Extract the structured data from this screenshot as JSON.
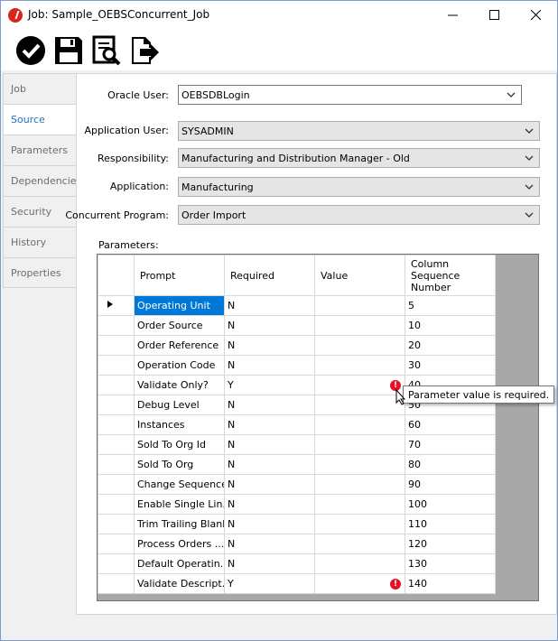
{
  "window": {
    "title": "Job: Sample_OEBSConcurrent_Job",
    "brand_color": "#d9261c"
  },
  "toolbar": {
    "icons": [
      "check-circle-icon",
      "save-icon",
      "search-document-icon",
      "export-icon"
    ]
  },
  "tabs": [
    "Job",
    "Source",
    "Parameters",
    "Dependencies",
    "Security",
    "History",
    "Properties"
  ],
  "form": {
    "oracle_user_label": "Oracle User:",
    "oracle_user_value": "OEBSDBLogin",
    "app_user_label": "Application User:",
    "app_user_value": "SYSADMIN",
    "responsibility_label": "Responsibility:",
    "responsibility_value": "Manufacturing and Distribution Manager - Old",
    "application_label": "Application:",
    "application_value": "Manufacturing",
    "program_label": "Concurrent Program:",
    "program_value": "Order Import",
    "parameters_label": "Parameters:"
  },
  "grid": {
    "headers": {
      "prompt": "Prompt",
      "required": "Required",
      "value": "Value",
      "seq_line1": "Column",
      "seq_line2": "Sequence",
      "seq_line3": "Number"
    },
    "rows": [
      {
        "prompt": "Operating Unit",
        "required": "N",
        "value": "",
        "seq": "5"
      },
      {
        "prompt": "Order Source",
        "required": "N",
        "value": "",
        "seq": "10"
      },
      {
        "prompt": "Order Reference",
        "required": "N",
        "value": "",
        "seq": "20"
      },
      {
        "prompt": "Operation Code",
        "required": "N",
        "value": "",
        "seq": "30"
      },
      {
        "prompt": "Validate Only?",
        "required": "Y",
        "value": "",
        "seq": "40"
      },
      {
        "prompt": "Debug Level",
        "required": "N",
        "value": "",
        "seq": "50"
      },
      {
        "prompt": "Instances",
        "required": "N",
        "value": "",
        "seq": "60"
      },
      {
        "prompt": "Sold To Org Id",
        "required": "N",
        "value": "",
        "seq": "70"
      },
      {
        "prompt": "Sold To Org",
        "required": "N",
        "value": "",
        "seq": "80"
      },
      {
        "prompt": "Change Sequence",
        "required": "N",
        "value": "",
        "seq": "90"
      },
      {
        "prompt": "Enable Single Lin...",
        "required": "N",
        "value": "",
        "seq": "100"
      },
      {
        "prompt": "Trim Trailing Blanks",
        "required": "N",
        "value": "",
        "seq": "110"
      },
      {
        "prompt": "Process Orders ...",
        "required": "N",
        "value": "",
        "seq": "120"
      },
      {
        "prompt": "Default Operatin...",
        "required": "N",
        "value": "",
        "seq": "130"
      },
      {
        "prompt": "Validate Descript...",
        "required": "Y",
        "value": "",
        "seq": "140"
      }
    ],
    "error_glyph": "!"
  },
  "tooltip": {
    "text": "Parameter value is required."
  }
}
